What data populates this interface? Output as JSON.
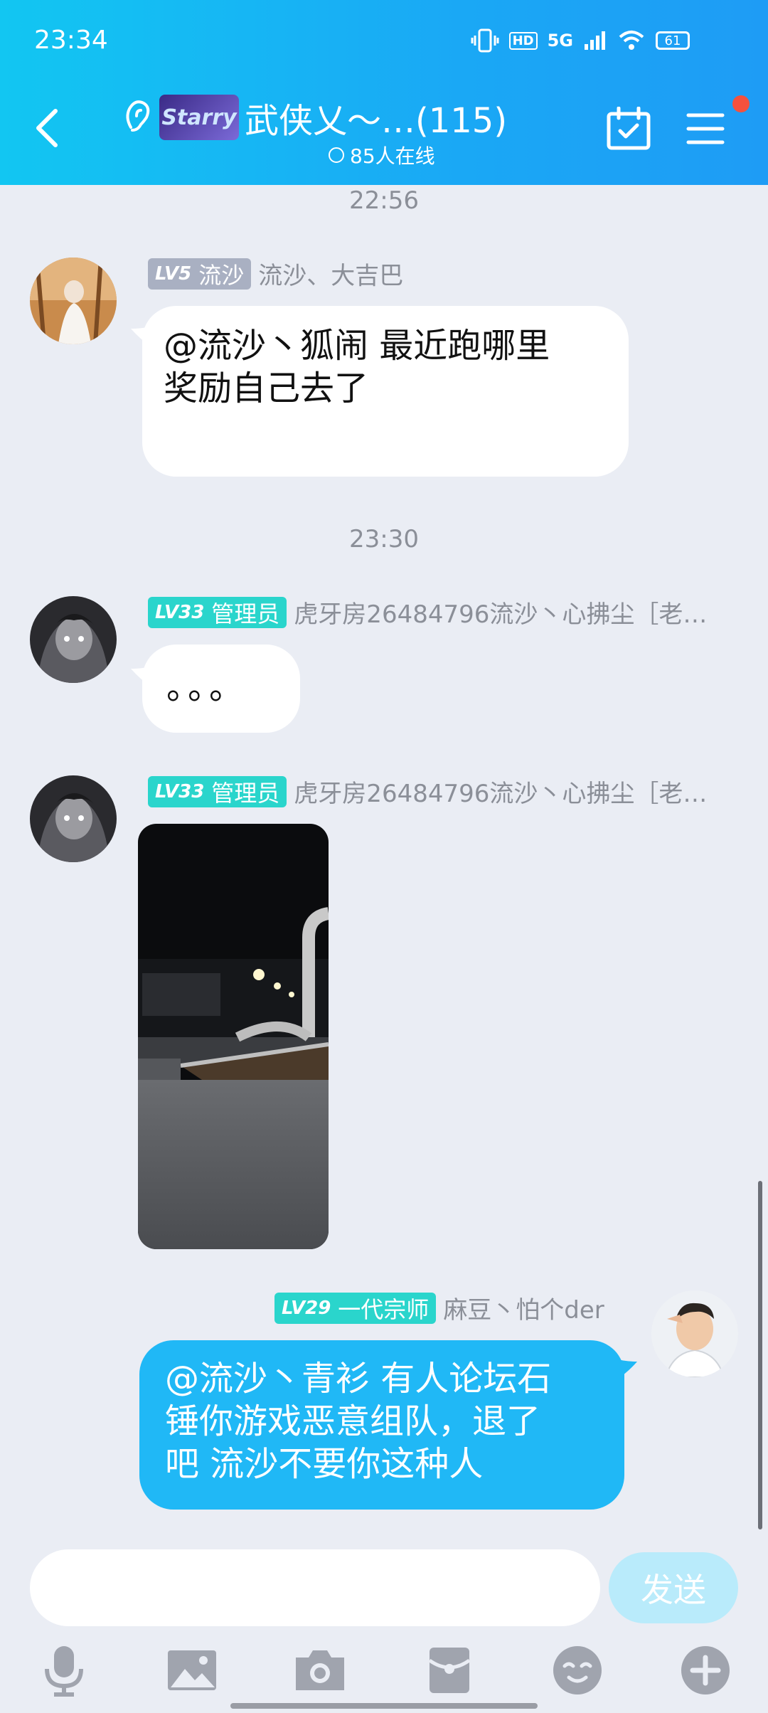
{
  "status_bar": {
    "time": "23:34",
    "network": "5G",
    "hd": "HD",
    "battery": "61"
  },
  "header": {
    "logo_text": "Starry",
    "title": "武侠乂～…(115)",
    "online_text": "85人在线"
  },
  "messages": [
    {
      "time": "22:56",
      "level": "LV5",
      "role": "流沙",
      "name": "流沙、大吉巴",
      "text_lines": [
        "@流沙丶狐闹 最近跑哪里",
        "奖励自己去了"
      ]
    },
    {
      "time": "23:30",
      "level": "LV33",
      "role": "管理员",
      "name": "虎牙房26484796流沙丶心拂尘［老…",
      "text": "。。。"
    },
    {
      "level": "LV33",
      "role": "管理员",
      "name": "虎牙房26484796流沙丶心拂尘［老…",
      "image": "night-street-photo"
    },
    {
      "level": "LV29",
      "role": "一代宗师",
      "name": "麻豆丶怕个der",
      "text_lines": [
        "@流沙丶青衫 有人论坛石",
        "锤你游戏恶意组队，退了",
        "吧 流沙不要你这种人"
      ]
    }
  ],
  "input": {
    "placeholder": "",
    "send_label": "发送"
  },
  "toolbar": [
    "mic-icon",
    "image-icon",
    "camera-icon",
    "red-packet-icon",
    "emoji-icon",
    "plus-icon"
  ],
  "colors": {
    "header": "#1aa8f5",
    "bubble_self": "#20b8f6",
    "badge_admin": "#2ad5cc",
    "badge_low": "#a9b0c2"
  }
}
